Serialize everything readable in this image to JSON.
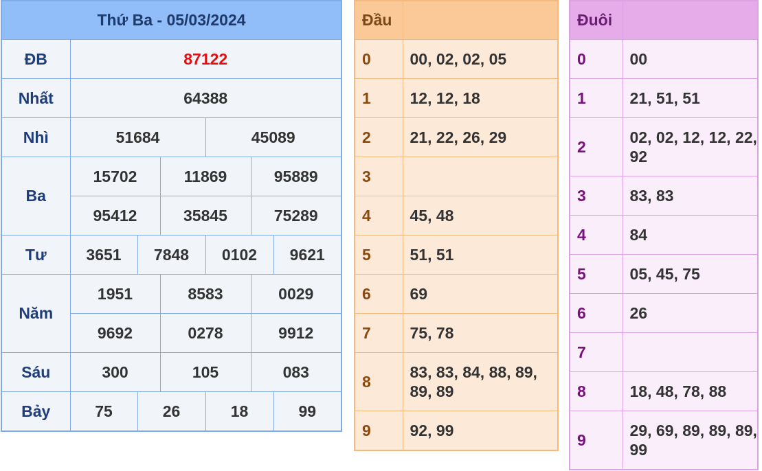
{
  "results": {
    "title": "Thứ Ba - 05/03/2024",
    "prizes": {
      "db": {
        "label": "ĐB",
        "values": [
          "87122"
        ]
      },
      "nhat": {
        "label": "Nhất",
        "values": [
          "64388"
        ]
      },
      "nhi": {
        "label": "Nhì",
        "values": [
          "51684",
          "45089"
        ]
      },
      "ba": {
        "label": "Ba",
        "values": [
          "15702",
          "11869",
          "95889",
          "95412",
          "35845",
          "75289"
        ]
      },
      "tu": {
        "label": "Tư",
        "values": [
          "3651",
          "7848",
          "0102",
          "9621"
        ]
      },
      "nam": {
        "label": "Năm",
        "values": [
          "1951",
          "8583",
          "0029",
          "9692",
          "0278",
          "9912"
        ]
      },
      "sau": {
        "label": "Sáu",
        "values": [
          "300",
          "105",
          "083"
        ]
      },
      "bay": {
        "label": "Bảy",
        "values": [
          "75",
          "26",
          "18",
          "99"
        ]
      }
    },
    "colors": {
      "header": "#91bdf8",
      "border": "#7fabe8",
      "special": "#e01010"
    }
  },
  "dau": {
    "title": "Đầu",
    "rows": [
      {
        "digit": "0",
        "values": "00, 02, 02, 05"
      },
      {
        "digit": "1",
        "values": "12, 12, 18"
      },
      {
        "digit": "2",
        "values": "21, 22, 26, 29"
      },
      {
        "digit": "3",
        "values": ""
      },
      {
        "digit": "4",
        "values": "45, 48"
      },
      {
        "digit": "5",
        "values": "51, 51"
      },
      {
        "digit": "6",
        "values": "69"
      },
      {
        "digit": "7",
        "values": "75, 78"
      },
      {
        "digit": "8",
        "values": "83, 83, 84, 88, 89, 89, 89"
      },
      {
        "digit": "9",
        "values": "92, 99"
      }
    ],
    "colors": {
      "header": "#fbc997",
      "border": "#f3b97f"
    }
  },
  "duoi": {
    "title": "Đuôi",
    "rows": [
      {
        "digit": "0",
        "values": "00"
      },
      {
        "digit": "1",
        "values": "21, 51, 51"
      },
      {
        "digit": "2",
        "values": "02, 02, 12, 12, 22, 92"
      },
      {
        "digit": "3",
        "values": "83, 83"
      },
      {
        "digit": "4",
        "values": "84"
      },
      {
        "digit": "5",
        "values": "05, 45, 75"
      },
      {
        "digit": "6",
        "values": "26"
      },
      {
        "digit": "7",
        "values": ""
      },
      {
        "digit": "8",
        "values": "18, 48, 78, 88"
      },
      {
        "digit": "9",
        "values": "29, 69, 89, 89, 89, 99"
      }
    ],
    "colors": {
      "header": "#e6abe9",
      "border": "#dba3e3"
    }
  }
}
